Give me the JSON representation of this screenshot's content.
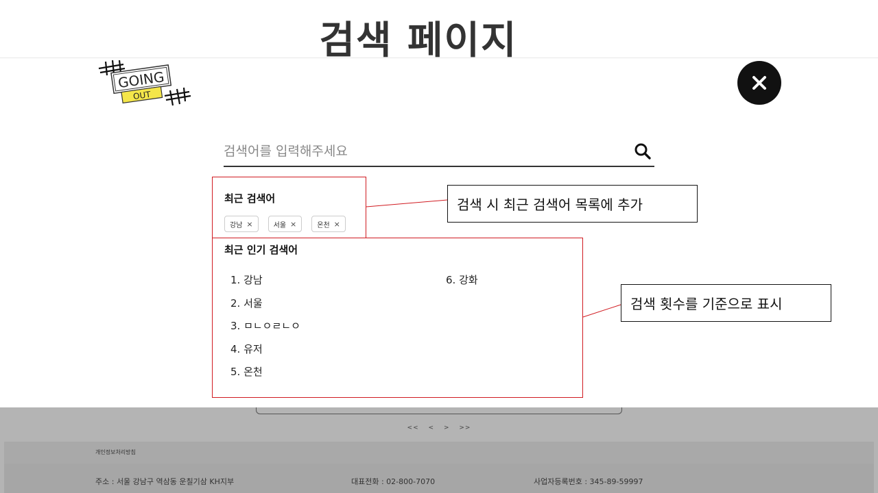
{
  "slide": {
    "title": "검색 페이지"
  },
  "logo": {
    "line1": "GOING",
    "line2": "OUT"
  },
  "search": {
    "placeholder": "검색어를 입력해주세요",
    "value": ""
  },
  "recent": {
    "title": "최근 검색어",
    "items": [
      "강남",
      "서울",
      "온천"
    ],
    "remove_glyph": "×"
  },
  "popular": {
    "title": "최근 인기 검색어",
    "items": [
      "1. 강남",
      "2. 서울",
      "3. ㅁㄴㅇㄹㄴㅇ",
      "4. 유저",
      "5. 온천",
      "6. 강화"
    ]
  },
  "annotations": {
    "recent_note": "검색 시 최근 검색어 목록에 추가",
    "popular_note": "검색 횟수를 기준으로 표시"
  },
  "pager": {
    "first": "<<",
    "prev": "<",
    "next": ">",
    "last": ">>"
  },
  "footer": {
    "privacy": "개인정보처리방침",
    "address": "주소 : 서울 강남구 역삼동 운칠기삼 KH지부",
    "phone": "대표전화 : 02-800-7070",
    "business_no": "사업자등록번호 : 345-89-59997"
  },
  "colors": {
    "annotation_border": "#d0191f",
    "footer_bg": "#b4b4b4",
    "close_bg": "#111111",
    "logo_yellow": "#f4e64a"
  },
  "icons": {
    "close": "close-icon",
    "search": "search-icon"
  }
}
